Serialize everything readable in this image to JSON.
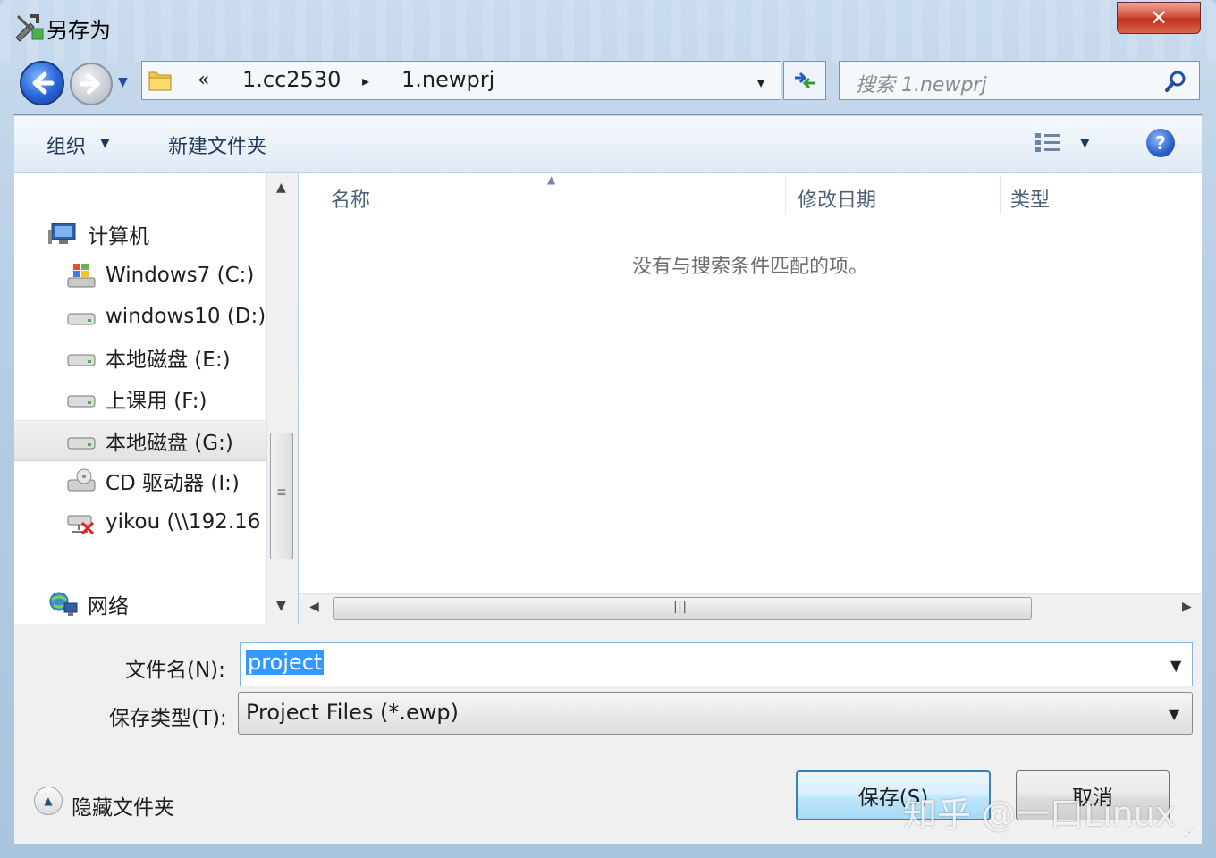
{
  "window": {
    "title": "另存为",
    "close_label": "✕"
  },
  "address_bar": {
    "overflow_chevron": "«",
    "segments": [
      "1.cc2530",
      "1.newprj"
    ],
    "separator": "▸",
    "dropdown": "▾"
  },
  "search": {
    "placeholder": "搜索 1.newprj"
  },
  "toolbar": {
    "organize_label": "组织",
    "new_folder_label": "新建文件夹",
    "help_label": "?"
  },
  "nav_pane": {
    "items": [
      {
        "label": "计算机",
        "icon": "computer-icon"
      },
      {
        "label": "Windows7 (C:)",
        "icon": "system-drive-icon"
      },
      {
        "label": "windows10 (D:)",
        "icon": "drive-icon"
      },
      {
        "label": "本地磁盘 (E:)",
        "icon": "drive-icon"
      },
      {
        "label": "上课用 (F:)",
        "icon": "drive-icon"
      },
      {
        "label": "本地磁盘 (G:)",
        "icon": "drive-icon",
        "selected": true
      },
      {
        "label": "CD 驱动器 (I:)",
        "icon": "cd-drive-icon"
      },
      {
        "label": "yikou (\\\\192.16",
        "icon": "network-drive-disconnected-icon"
      },
      {
        "label": "网络",
        "icon": "network-icon"
      }
    ]
  },
  "file_list": {
    "columns": [
      "名称",
      "修改日期",
      "类型"
    ],
    "empty_message": "没有与搜索条件匹配的项。"
  },
  "form": {
    "filename_label": "文件名(N):",
    "filename_value": "project",
    "filetype_label": "保存类型(T):",
    "filetype_value": "Project Files (*.ewp)"
  },
  "footer": {
    "hide_folders_label": "隐藏文件夹",
    "save_label": "保存(S)",
    "cancel_label": "取消"
  },
  "watermark": "知乎 @一口Linux",
  "colors": {
    "selection": "#3399ff",
    "close_button": "#c0301a",
    "accent": "#2763d6"
  }
}
